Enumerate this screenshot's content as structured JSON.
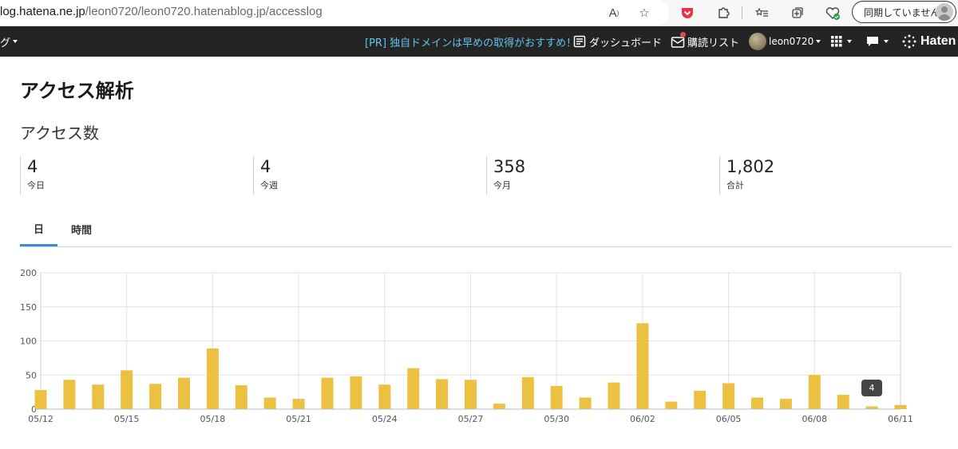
{
  "browser": {
    "url_host": "log.hatena.ne.jp",
    "url_path": "/leon0720/leon0720.hatenablog.jp/accesslog",
    "read_aloud_label": "A",
    "sync_label": "同期していません"
  },
  "navbar": {
    "blog_menu_label": "グ",
    "pr_text": "[PR] 独自ドメインは早めの取得がおすすめ！",
    "dashboard_label": "ダッシュボード",
    "subscriptions_label": "購読リスト",
    "username": "leon0720",
    "brand": "Haten"
  },
  "page": {
    "title": "アクセス解析",
    "section_title": "アクセス数"
  },
  "stats": [
    {
      "value": "4",
      "label": "今日"
    },
    {
      "value": "4",
      "label": "今週"
    },
    {
      "value": "358",
      "label": "今月"
    },
    {
      "value": "1,802",
      "label": "合計"
    }
  ],
  "tabs": [
    {
      "label": "日",
      "active": true
    },
    {
      "label": "時間",
      "active": false
    }
  ],
  "chart_data": {
    "type": "bar",
    "bar_color": "#ecc142",
    "ylim": [
      0,
      200
    ],
    "yticks": [
      0,
      50,
      100,
      150,
      200
    ],
    "xtick_labels": [
      "05/12",
      "05/15",
      "05/18",
      "05/21",
      "05/24",
      "05/27",
      "05/30",
      "06/02",
      "06/05",
      "06/08",
      "06/11"
    ],
    "categories": [
      "05/12",
      "05/13",
      "05/14",
      "05/15",
      "05/16",
      "05/17",
      "05/18",
      "05/19",
      "05/20",
      "05/21",
      "05/22",
      "05/23",
      "05/24",
      "05/25",
      "05/26",
      "05/27",
      "05/28",
      "05/29",
      "05/30",
      "05/31",
      "06/01",
      "06/02",
      "06/03",
      "06/04",
      "06/05",
      "06/06",
      "06/07",
      "06/08",
      "06/09",
      "06/10",
      "06/11"
    ],
    "values": [
      28,
      43,
      36,
      57,
      37,
      46,
      89,
      35,
      17,
      15,
      46,
      48,
      36,
      60,
      44,
      43,
      8,
      47,
      34,
      17,
      39,
      126,
      11,
      27,
      38,
      17,
      15,
      50,
      21,
      4,
      6
    ],
    "tooltip_value": "4"
  }
}
